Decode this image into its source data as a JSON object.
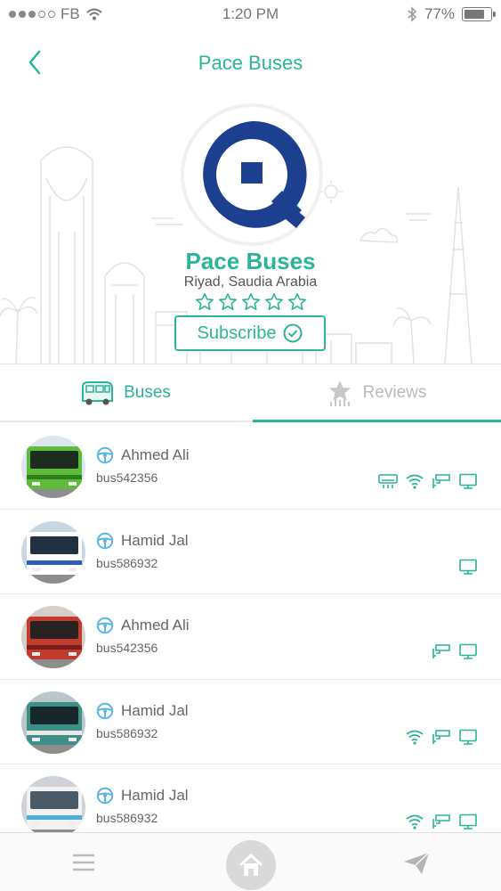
{
  "status_bar": {
    "carrier": "FB",
    "time": "1:20 PM",
    "battery": "77%",
    "battery_level": 0.77
  },
  "nav": {
    "title": "Pace Buses"
  },
  "company": {
    "name": "Pace Buses",
    "location": "Riyad, Saudia Arabia",
    "rating": 0,
    "rating_max": 5,
    "subscribe_label": "Subscribe"
  },
  "tabs": [
    {
      "label": "Buses",
      "active": true
    },
    {
      "label": "Reviews",
      "active": false
    }
  ],
  "buses": [
    {
      "driver": "Ahmed Ali",
      "bus_id": "bus542356",
      "amenities": [
        "ac-icon",
        "wifi-icon",
        "cctv-icon",
        "tv-icon"
      ],
      "photo": "green"
    },
    {
      "driver": "Hamid Jal",
      "bus_id": "bus586932",
      "amenities": [
        "tv-icon"
      ],
      "photo": "blue"
    },
    {
      "driver": "Ahmed Ali",
      "bus_id": "bus542356",
      "amenities": [
        "cctv-icon",
        "tv-icon"
      ],
      "photo": "red"
    },
    {
      "driver": "Hamid Jal",
      "bus_id": "bus586932",
      "amenities": [
        "wifi-icon",
        "cctv-icon",
        "tv-icon"
      ],
      "photo": "teal"
    },
    {
      "driver": "Hamid Jal",
      "bus_id": "bus586932",
      "amenities": [
        "wifi-icon",
        "cctv-icon",
        "tv-icon"
      ],
      "photo": "white"
    }
  ],
  "bottom_bar": {
    "items": [
      "menu-icon",
      "home-icon",
      "send-icon"
    ]
  },
  "colors": {
    "accent": "#2bb49a",
    "logo_blue": "#1d3f8f",
    "amenity": "#2bb49a",
    "inactive": "#bbbbbb"
  }
}
